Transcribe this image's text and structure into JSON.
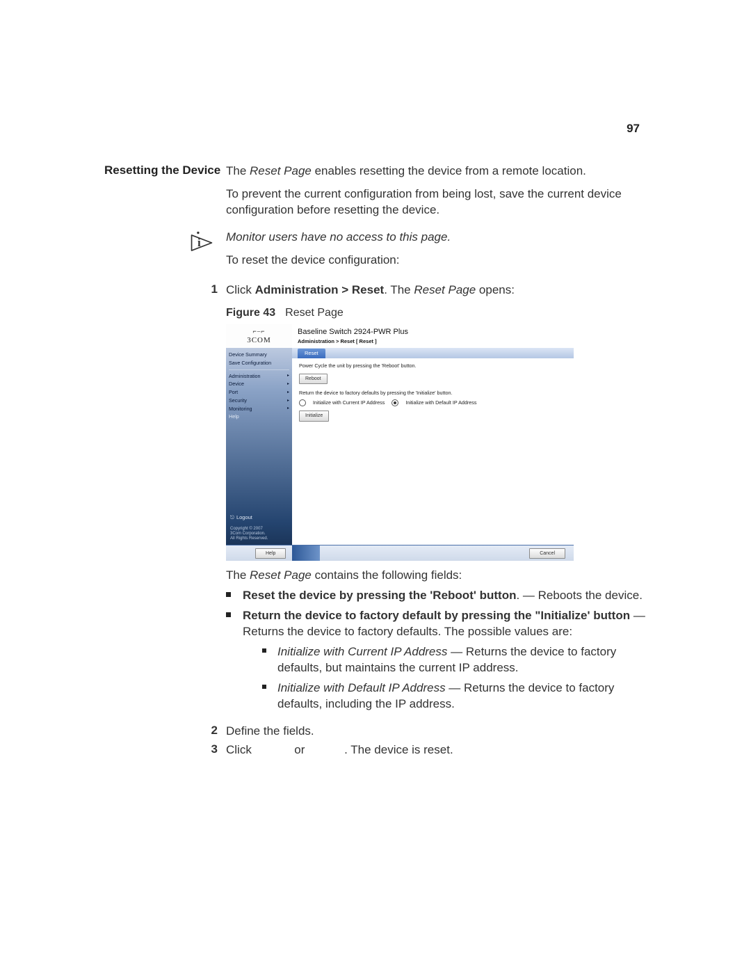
{
  "page_number": "97",
  "side_heading": "Resetting the Device",
  "intro_sentence_prefix": "The ",
  "intro_sentence_em": "Reset Page",
  "intro_sentence_suffix": " enables resetting the device from a remote location.",
  "para_prevent": "To prevent the current configuration from being lost, save the current device configuration before resetting the device.",
  "note_monitor": "Monitor users have no access to this page.",
  "para_to_reset": "To reset the device configuration:",
  "step1_prefix": "Click ",
  "step1_bold": "Administration > Reset",
  "step1_mid": ". The ",
  "step1_em": "Reset Page",
  "step1_suffix": " opens:",
  "figure_label": "Figure 43",
  "figure_title": "Reset Page",
  "screenshot": {
    "logo_brand": "3COM",
    "logo_top_glyph": "⌐⎯⌐",
    "sidebar": {
      "item_device_summary": "Device Summary",
      "item_save_config": "Save Configuration",
      "item_admin": "Administration",
      "item_device": "Device",
      "item_port": "Port",
      "item_security": "Security",
      "item_monitoring": "Monitoring",
      "item_help": "Help",
      "logout": "Logout",
      "copyright_l1": "Copyright © 2007",
      "copyright_l2": "3Com Corporation.",
      "copyright_l3": "All Rights Reserved."
    },
    "header_title": "Baseline Switch 2924-PWR Plus",
    "breadcrumb": "Administration > Reset [ Reset ]",
    "tab_label": "Reset",
    "body": {
      "line_power_cycle": "Power Cycle the unit by pressing the 'Reboot' button.",
      "btn_reboot": "Reboot",
      "line_return_factory": "Return the device to factory defaults by pressing the 'Initialize' button.",
      "radio_current": "Initialize with Current IP Address",
      "radio_default": "Initialize with Default IP Address",
      "btn_initialize": "Initialize"
    },
    "footer": {
      "btn_help": "Help",
      "btn_cancel": "Cancel"
    }
  },
  "after_fig_prefix": "The ",
  "after_fig_em": "Reset Page",
  "after_fig_suffix": " contains the following fields:",
  "bullets": {
    "b1_bold": "Reset the device by pressing the 'Reboot' button",
    "b1_suffix": ". — Reboots the device.",
    "b2_bold": "Return the device to factory default by pressing the \"Initialize' button",
    "b2_suffix": " — Returns the device to factory defaults. The possible values are:",
    "b2a_em": "Initialize with Current IP Address",
    "b2a_suffix": " — Returns the device to factory defaults, but maintains the current IP address.",
    "b2b_em": "Initialize with Default IP Address",
    "b2b_suffix": " — Returns the device to factory defaults, including the IP address."
  },
  "step2_text": "Define the fields.",
  "step3_prefix": "Click ",
  "step3_or": " or ",
  "step3_suffix": ". The device is reset.",
  "nums": {
    "n1": "1",
    "n2": "2",
    "n3": "3"
  }
}
